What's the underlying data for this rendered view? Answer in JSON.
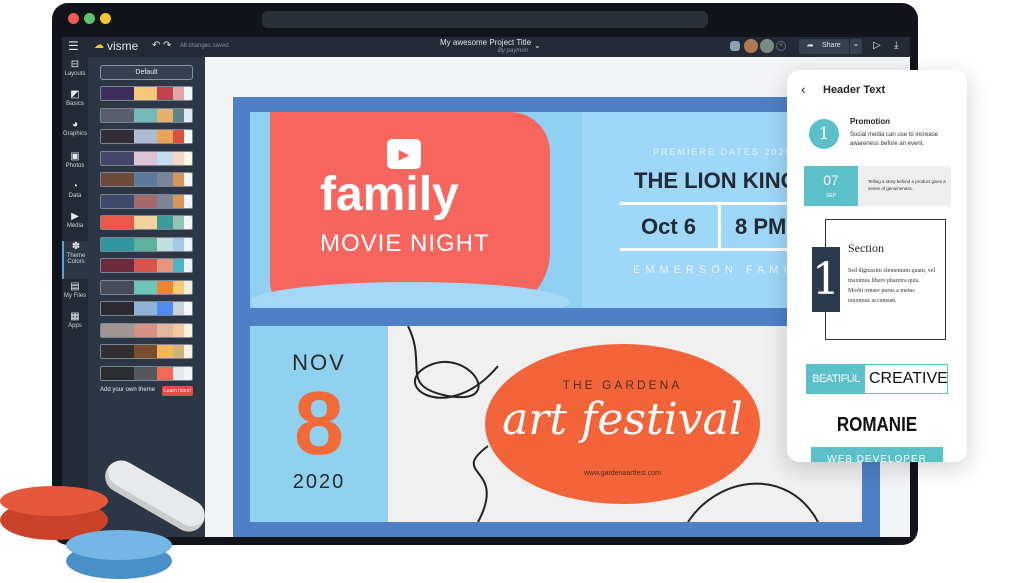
{
  "app": {
    "logo": "visme",
    "save_status": "All changes saved",
    "project_title": "My awesome Project Title",
    "project_author": "By paymon",
    "share_label": "Share"
  },
  "sidebar": {
    "items": [
      {
        "label": "Layouts",
        "icon": "layout-icon"
      },
      {
        "label": "Basics",
        "icon": "shapes-icon"
      },
      {
        "label": "Graphics",
        "icon": "graphics-icon"
      },
      {
        "label": "Photos",
        "icon": "photo-icon"
      },
      {
        "label": "Data",
        "icon": "chart-icon"
      },
      {
        "label": "Media",
        "icon": "media-icon"
      },
      {
        "label": "Theme Colors",
        "icon": "palette-icon",
        "active": true
      },
      {
        "label": "My Files",
        "icon": "folder-icon"
      },
      {
        "label": "Apps",
        "icon": "apps-icon"
      }
    ]
  },
  "theme_panel": {
    "default_label": "Default",
    "add_theme_label": "Add your own theme",
    "learn_more_label": "Learn more!",
    "palettes": [
      [
        "#3d2f5c",
        "#f5c87c",
        "#c4404f",
        "#e3a6a8",
        "#f2f4fa"
      ],
      [
        "#5a5e6a",
        "#75b9b8",
        "#e6b06f",
        "#5f8484",
        "#e1e9f6"
      ],
      [
        "#322b38",
        "#a8bcd2",
        "#eba457",
        "#d9503f",
        "#f8f8fb"
      ],
      [
        "#46456a",
        "#dcc4d7",
        "#c6ddef",
        "#f8d6c6",
        "#fdf8e4"
      ],
      [
        "#6e4a3c",
        "#5b7a9c",
        "#7a8597",
        "#d6955b",
        "#f4f5f8"
      ],
      [
        "#3f4a6a",
        "#a7686d",
        "#7d8595",
        "#d6955b",
        "#f4f5f8"
      ],
      [
        "#ea5a4a",
        "#f3d49f",
        "#3f9a9a",
        "#95c2b5",
        "#f3f5f7"
      ],
      [
        "#2f96a2",
        "#5eb19a",
        "#c3e0de",
        "#a6c7e8",
        "#eef2f9"
      ],
      [
        "#6b2b3c",
        "#d6544d",
        "#e7957f",
        "#4fb4c6",
        "#eff3f8"
      ],
      [
        "#474a58",
        "#6dc5b7",
        "#ee8438",
        "#f3c877",
        "#f3ede0"
      ],
      [
        "#2d2a31",
        "#90b1d8",
        "#4f8cf0",
        "#c8d3de",
        "#f8f8fb"
      ],
      [
        "#a09794",
        "#d69187",
        "#e4b79e",
        "#f0c9a0",
        "#fff5e2"
      ],
      [
        "#332e30",
        "#7a4e2c",
        "#f3b65a",
        "#cdb47e",
        "#f4f1e7"
      ],
      [
        "#2c2d30",
        "#55575e",
        "#f06a55",
        "#e6e8ec",
        "#f3f5fa"
      ]
    ]
  },
  "poster": {
    "movie": {
      "title_line1": "family",
      "title_line2": "MOVIE NIGHT",
      "premiere": "PREMIERE DATES 2020",
      "film": "THE LION KING",
      "date": "Oct 6",
      "time": "8 PM",
      "host": "EMMERSON FAMILY"
    },
    "art": {
      "month": "NOV",
      "day": "8",
      "year": "2020",
      "pre": "THE GARDENA",
      "title": "art festival",
      "url": "www.gardenaartfest.com"
    }
  },
  "phone": {
    "header": "Header Text",
    "promo_number": "1",
    "promo_title": "Promotion",
    "promo_text": "Social media can use to increase awareness before an event.",
    "date_day": "07",
    "date_month": "SEP",
    "date_text": "Telling a story behind a product gives a sense of genuineness.",
    "section_number": "1",
    "section_title": "Section",
    "section_text": "Sed dignissim elementum quam, vel maximus libero pharetra quis. Morbi ornare purus a metus maximus accumsan.",
    "badge_left": "BEATIFUL",
    "badge_right": "CREATIVE",
    "name": "ROMANIE",
    "role": "WEB DEVELOPER"
  },
  "colors": {
    "accent": "#49a8d8",
    "coral": "#f6665f",
    "teal": "#5bc0c9",
    "orange": "#f3643a"
  }
}
